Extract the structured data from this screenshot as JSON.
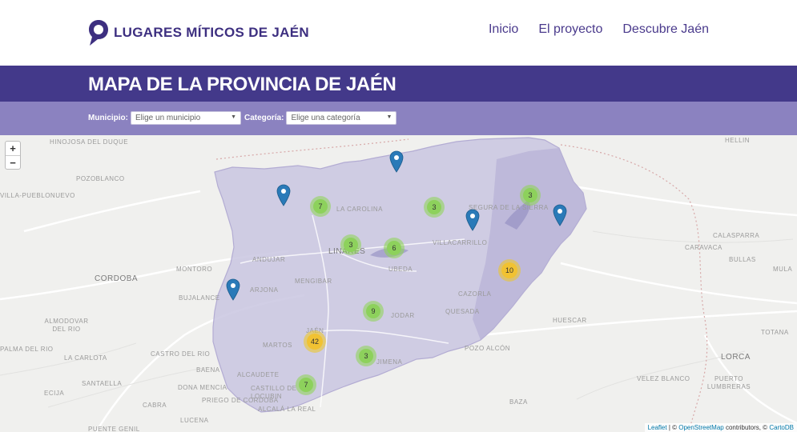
{
  "header": {
    "logo_text": "LUGARES MÍTICOS DE JAÉN",
    "nav": [
      "Inicio",
      "El proyecto",
      "Descubre Jaén"
    ]
  },
  "title": "MAPA DE LA PROVINCIA DE JAÉN",
  "filters": {
    "municipio": {
      "label": "Municipio:",
      "value": "Elige un municipio"
    },
    "categoria": {
      "label": "Categoría:",
      "value": "Elige una categoría"
    }
  },
  "map": {
    "zoom_in": "+",
    "zoom_out": "−",
    "places": [
      "POZOBLANCO",
      "CORDOBA",
      "MONTORO",
      "BUJALANCE",
      "ANDUJAR",
      "ARJONA",
      "MENGIBAR",
      "JAÉN",
      "MARTOS",
      "ALCAUDETE",
      "CASTILLO DE LOCUBIN",
      "ALCALÁ LA REAL",
      "BAENA",
      "DONA MENCIA",
      "PRIEGO DE CORDOBA",
      "LA CAROLINA",
      "LINARES",
      "UBEDA",
      "JODAR",
      "JIMENA",
      "VILLACARRILLO",
      "CAZORLA",
      "QUESADA",
      "POZO ALCÓN",
      "HUESCAR",
      "BAZA",
      "TOTANA",
      "LORCA",
      "PUERTO LUMBRERAS",
      "VELEZ BLANCO",
      "CARAVACA",
      "BULLAS",
      "MULA",
      "CALASPARRA",
      "HELLIN",
      "ALMODOVAR DEL RIO",
      "PALMA DEL RIO",
      "LA CARLOTA",
      "SANTAELLA",
      "CASTRO DEL RIO",
      "CABRA",
      "LUCENA",
      "PUENTE GENIL",
      "PRIEGO",
      "HINOJOSA DEL DUQUE",
      "VILLA-PUEBLONUEVO",
      "SEGURA DE LA SIERRA",
      "ECIJA"
    ],
    "clusters": [
      {
        "count": "7",
        "color": "green"
      },
      {
        "count": "3",
        "color": "green"
      },
      {
        "count": "3",
        "color": "green"
      },
      {
        "count": "3",
        "color": "green"
      },
      {
        "count": "6",
        "color": "green"
      },
      {
        "count": "10",
        "color": "yellow"
      },
      {
        "count": "9",
        "color": "green"
      },
      {
        "count": "42",
        "color": "yellow"
      },
      {
        "count": "3",
        "color": "green"
      },
      {
        "count": "7",
        "color": "green"
      }
    ],
    "attribution": {
      "leaflet": "Leaflet",
      "osm": "OpenStreetMap",
      "contributors": " contributors, © ",
      "carto": "CartoDB"
    }
  },
  "colors": {
    "brand": "#3d2f80",
    "title_band": "#43398a",
    "filter_band": "#8b82c0",
    "province_fill": "#c9c5e0",
    "pin": "#2a7ab8",
    "cluster_green": "#8dd15c",
    "cluster_yellow": "#f1c232"
  }
}
